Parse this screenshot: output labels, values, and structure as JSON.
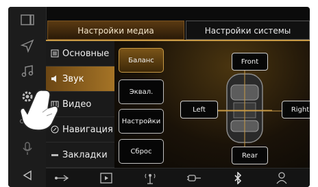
{
  "tabs": {
    "media": "Настройки медиа",
    "system": "Настройки системы"
  },
  "menu": [
    {
      "label": "Основные",
      "icon": "list-icon"
    },
    {
      "label": "Звук",
      "icon": "speaker-icon",
      "active": true
    },
    {
      "label": "Видео",
      "icon": "film-icon"
    },
    {
      "label": "Навигация",
      "icon": "navigation-icon"
    },
    {
      "label": "Закладки",
      "icon": "bookmark-icon"
    }
  ],
  "sound_buttons": [
    "Баланс",
    "Эквал.",
    "Настройки",
    "Сброс"
  ],
  "balance": {
    "front": "Front",
    "rear": "Rear",
    "left": "Left",
    "right": "Right"
  },
  "colors": {
    "accent": "#c89a45",
    "active_tab": "#6b4614"
  },
  "rail_icons": [
    "window-icon",
    "navigation-arrow-icon",
    "music-icon",
    "settings-gear-icon",
    "more-icon",
    "microphone-icon",
    "back-icon"
  ],
  "bottom_icons": [
    "usb-icon",
    "video-icon",
    "radio-antenna-icon",
    "aux-plug-icon",
    "bluetooth-icon",
    "phone-link-icon"
  ]
}
